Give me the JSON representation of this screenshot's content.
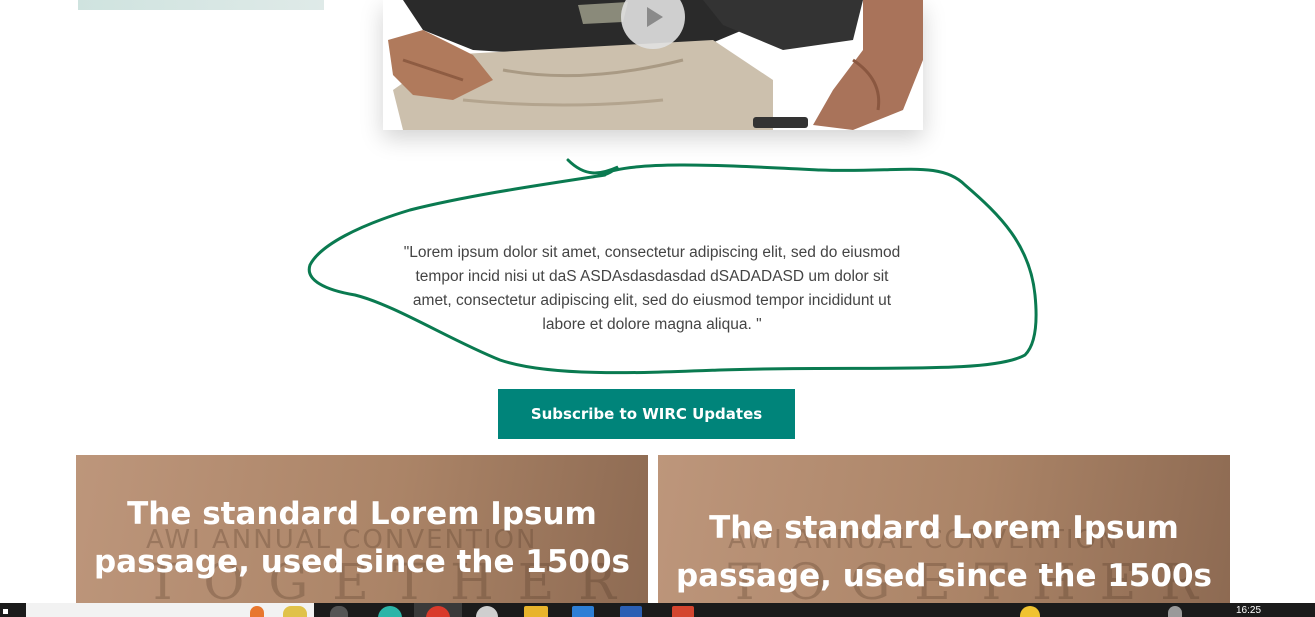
{
  "video": {
    "play_label": ""
  },
  "testimonial": {
    "quote": "\"Lorem ipsum dolor sit amet, consectetur adipiscing elit, sed do eiusmod tempor incid nisi ut daS ASDAsdasdasdad dSADADASD um dolor sit amet, consectetur adipiscing elit, sed do eiusmod tempor incididunt ut labore et dolore magna aliqua. \"",
    "annotation_color": "#0a7a50"
  },
  "subscribe": {
    "label": "Subscribe to WIRC Updates",
    "color": "#00847a"
  },
  "promos": [
    {
      "title": "The standard Lorem Ipsum passage, used since the 1500s",
      "watermark_line1": "AWI ANNUAL CONVENTION",
      "watermark_line2": "TOGETHER"
    },
    {
      "title": "The standard Lorem Ipsum passage, used since the 1500s",
      "watermark_line1": "AWI ANNUAL CONVENTION",
      "watermark_line2": "TOGETHER"
    }
  ],
  "taskbar": {
    "clock": "16:25",
    "icons": [
      "start-icon",
      "search-box",
      "task-view-icon",
      "edge-icon",
      "chrome-icon",
      "obs-icon",
      "file-explorer-icon",
      "store-icon",
      "word-icon",
      "skype-icon",
      "app-icon",
      "weather-icon",
      "network-icon"
    ]
  }
}
